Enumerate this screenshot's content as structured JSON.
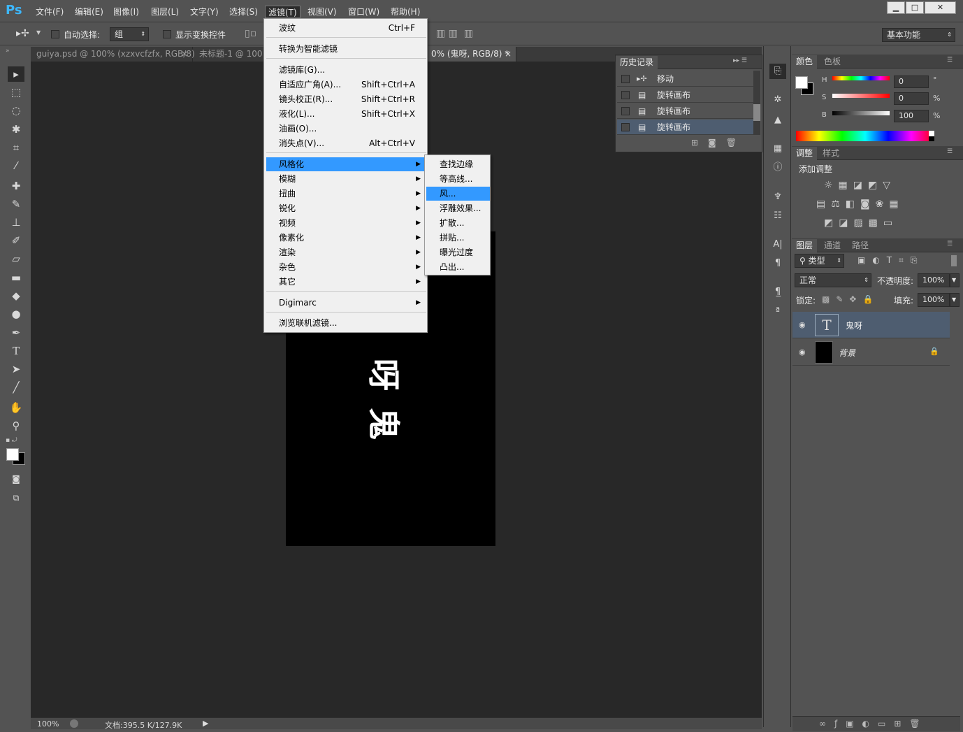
{
  "app": {
    "logo": "Ps",
    "workspace": "基本功能"
  },
  "menubar": [
    "文件(F)",
    "编辑(E)",
    "图像(I)",
    "图层(L)",
    "文字(Y)",
    "选择(S)",
    "滤镜(T)",
    "视图(V)",
    "窗口(W)",
    "帮助(H)"
  ],
  "window_buttons": {
    "min": "▁",
    "max": "□",
    "close": "✕"
  },
  "options": {
    "auto_select_label": "自动选择:",
    "auto_select_value": "组",
    "show_transform_label": "显示变换控件"
  },
  "tabs": [
    {
      "label": "guiya.psd @ 100% (xzxvcfzfx, RGB/8)",
      "close": "×"
    },
    {
      "label": "未标题-1 @ 100",
      "close": ""
    },
    {
      "label": "0% (鬼呀, RGB/8) *",
      "close": "×"
    }
  ],
  "canvas": {
    "glyph1": "呀",
    "glyph2": "鬼"
  },
  "status": {
    "zoom": "100%",
    "doc": "文档:395.5 K/127.9K"
  },
  "filter_menu": {
    "items": [
      {
        "label": "波纹",
        "shortcut": "Ctrl+F"
      },
      {
        "label": "转换为智能滤镜",
        "shortcut": ""
      },
      {
        "label": "滤镜库(G)...",
        "shortcut": ""
      },
      {
        "label": "自适应广角(A)...",
        "shortcut": "Shift+Ctrl+A"
      },
      {
        "label": "镜头校正(R)...",
        "shortcut": "Shift+Ctrl+R"
      },
      {
        "label": "液化(L)...",
        "shortcut": "Shift+Ctrl+X"
      },
      {
        "label": "油画(O)...",
        "shortcut": ""
      },
      {
        "label": "消失点(V)...",
        "shortcut": "Alt+Ctrl+V"
      },
      {
        "label": "风格化",
        "shortcut": ""
      },
      {
        "label": "模糊",
        "shortcut": ""
      },
      {
        "label": "扭曲",
        "shortcut": ""
      },
      {
        "label": "锐化",
        "shortcut": ""
      },
      {
        "label": "视频",
        "shortcut": ""
      },
      {
        "label": "像素化",
        "shortcut": ""
      },
      {
        "label": "渲染",
        "shortcut": ""
      },
      {
        "label": "杂色",
        "shortcut": ""
      },
      {
        "label": "其它",
        "shortcut": ""
      },
      {
        "label": "Digimarc",
        "shortcut": ""
      },
      {
        "label": "浏览联机滤镜...",
        "shortcut": ""
      }
    ]
  },
  "stylize_submenu": [
    "查找边缘",
    "等高线...",
    "风...",
    "浮雕效果...",
    "扩散...",
    "拼贴...",
    "曝光过度",
    "凸出..."
  ],
  "history": {
    "title": "历史记录",
    "rows": [
      "移动",
      "旋转画布",
      "旋转画布",
      "旋转画布"
    ]
  },
  "color_panel": {
    "tabs": [
      "颜色",
      "色板"
    ],
    "labels": [
      "H",
      "S",
      "B"
    ],
    "values": [
      "0",
      "0",
      "100"
    ],
    "units": [
      "°",
      "%",
      "%"
    ]
  },
  "adjust_panel": {
    "tabs": [
      "调整",
      "样式"
    ],
    "add_label": "添加调整"
  },
  "layers_panel": {
    "tabs": [
      "图层",
      "通道",
      "路径"
    ],
    "filter": "类型",
    "blend": "正常",
    "opacity_label": "不透明度:",
    "opacity": "100%",
    "lock_label": "锁定:",
    "fill_label": "填充:",
    "fill": "100%",
    "layers": [
      {
        "name": "鬼呀",
        "type": "T"
      },
      {
        "name": "背景",
        "type": ""
      }
    ]
  }
}
